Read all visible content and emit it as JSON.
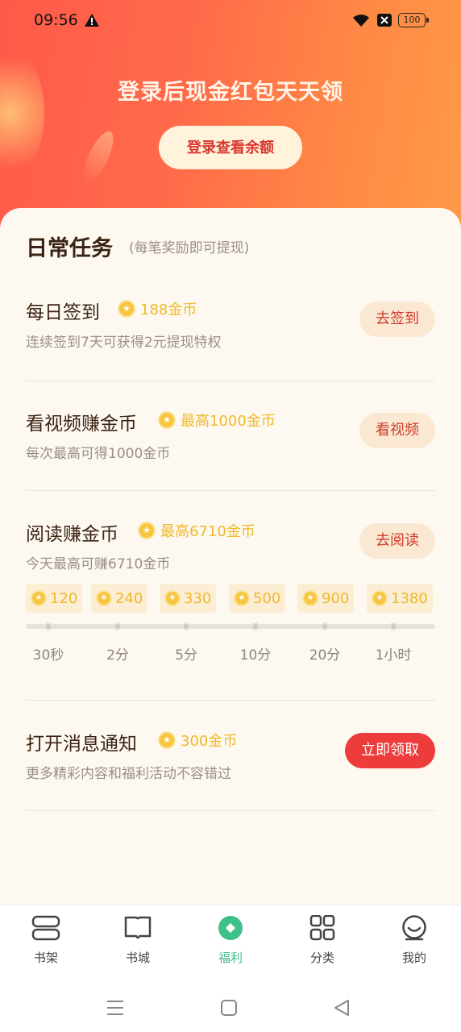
{
  "status": {
    "time": "09:56",
    "battery": "100"
  },
  "hero": {
    "title": "登录后现金红包天天领",
    "login_button": "登录查看余额"
  },
  "section": {
    "title": "日常任务",
    "subtitle": "(每笔奖励即可提现)"
  },
  "tasks": [
    {
      "title": "每日签到",
      "reward": "188金币",
      "desc": "连续签到7天可获得2元提现特权",
      "button": "去签到"
    },
    {
      "title": "看视频赚金币",
      "reward": "最高1000金币",
      "desc": "每次最高可得1000金币",
      "button": "看视频"
    },
    {
      "title": "阅读赚金币",
      "reward": "最高6710金币",
      "desc": "今天最高可赚6710金币",
      "button": "去阅读"
    },
    {
      "title": "打开消息通知",
      "reward": "300金币",
      "desc": "更多精彩内容和福利活动不容错过",
      "button": "立即领取"
    }
  ],
  "reading_milestones": [
    {
      "coins": "120",
      "time": "30秒"
    },
    {
      "coins": "240",
      "time": "2分"
    },
    {
      "coins": "330",
      "time": "5分"
    },
    {
      "coins": "500",
      "time": "10分"
    },
    {
      "coins": "900",
      "time": "20分"
    },
    {
      "coins": "1380",
      "time": "1小时"
    }
  ],
  "tabbar": [
    {
      "label": "书架",
      "icon": "bookshelf-icon"
    },
    {
      "label": "书城",
      "icon": "book-icon"
    },
    {
      "label": "福利",
      "icon": "welfare-icon",
      "active": true
    },
    {
      "label": "分类",
      "icon": "grid-icon"
    },
    {
      "label": "我的",
      "icon": "profile-icon"
    }
  ],
  "colors": {
    "accent": "#ee3b3c",
    "coin": "#f0b82a",
    "active_tab": "#3fbf8a",
    "hero_start": "#ff5a4a",
    "hero_end": "#ff9a48"
  }
}
